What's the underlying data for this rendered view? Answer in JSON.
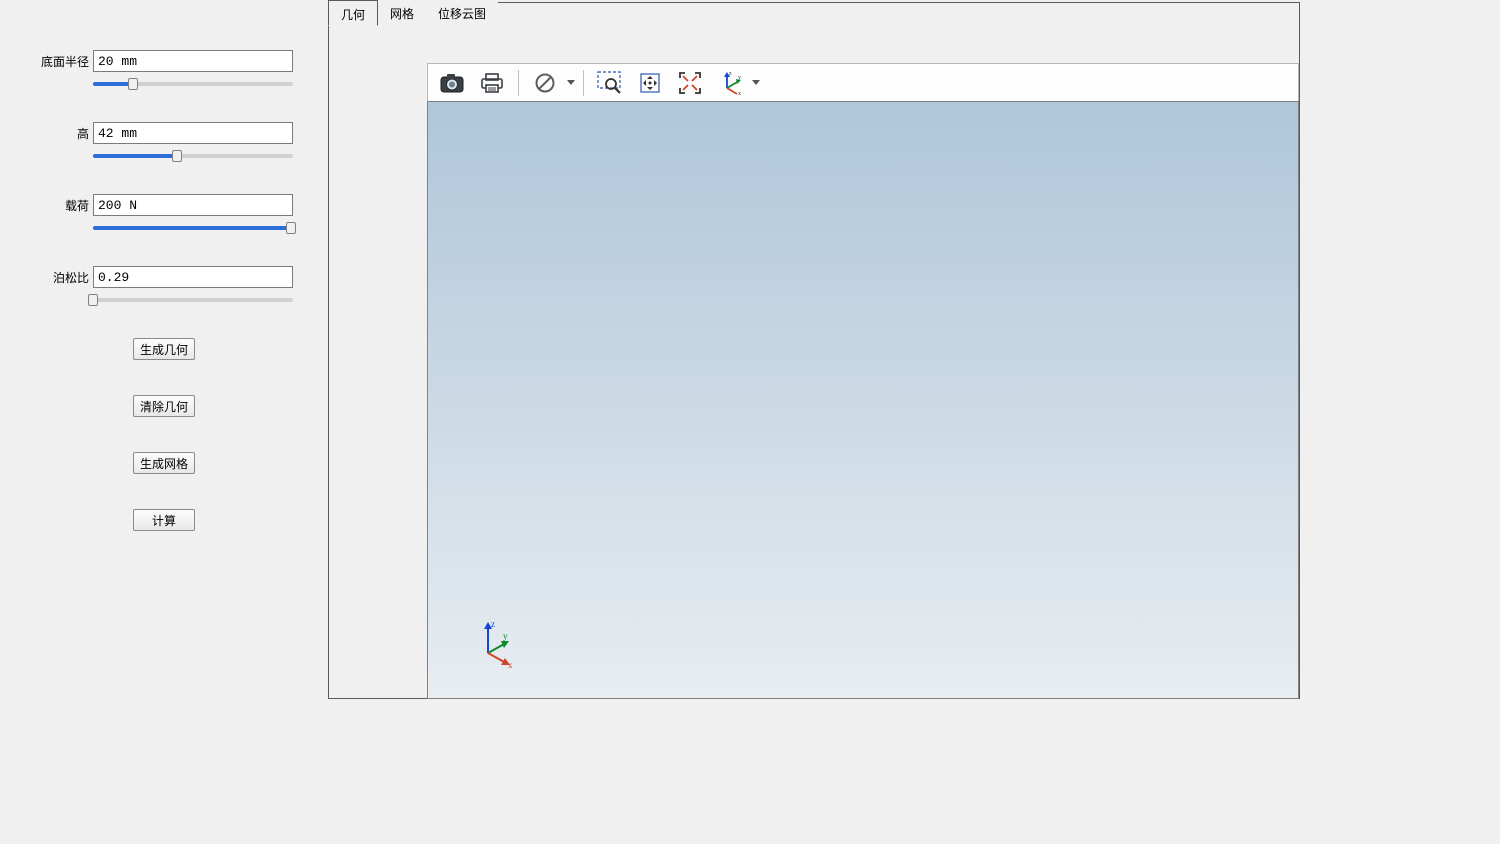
{
  "sidebar": {
    "params": [
      {
        "label": "底面半径",
        "value": "20 mm",
        "slider_percent": 20
      },
      {
        "label": "高",
        "value": "42 mm",
        "slider_percent": 42
      },
      {
        "label": "载荷",
        "value": "200 N",
        "slider_percent": 99
      },
      {
        "label": "泊松比",
        "value": "0.29",
        "slider_percent": 0
      }
    ],
    "buttons": {
      "generate_geom": "生成几何",
      "clear_geom": "清除几何",
      "generate_mesh": "生成网格",
      "compute": "计算"
    }
  },
  "tabs": [
    {
      "label": "几何",
      "active": true
    },
    {
      "label": "网格",
      "active": false
    },
    {
      "label": "位移云图",
      "active": false
    }
  ],
  "toolbar_icons": {
    "camera": "camera-icon",
    "print": "print-icon",
    "nosymbol": "no-entry-icon",
    "zoom_box": "zoom-box-icon",
    "pan": "pan-icon",
    "fit": "fit-extents-icon",
    "orient": "axis-orient-icon"
  },
  "axis_labels": {
    "x": "x",
    "y": "y",
    "z": "z"
  }
}
